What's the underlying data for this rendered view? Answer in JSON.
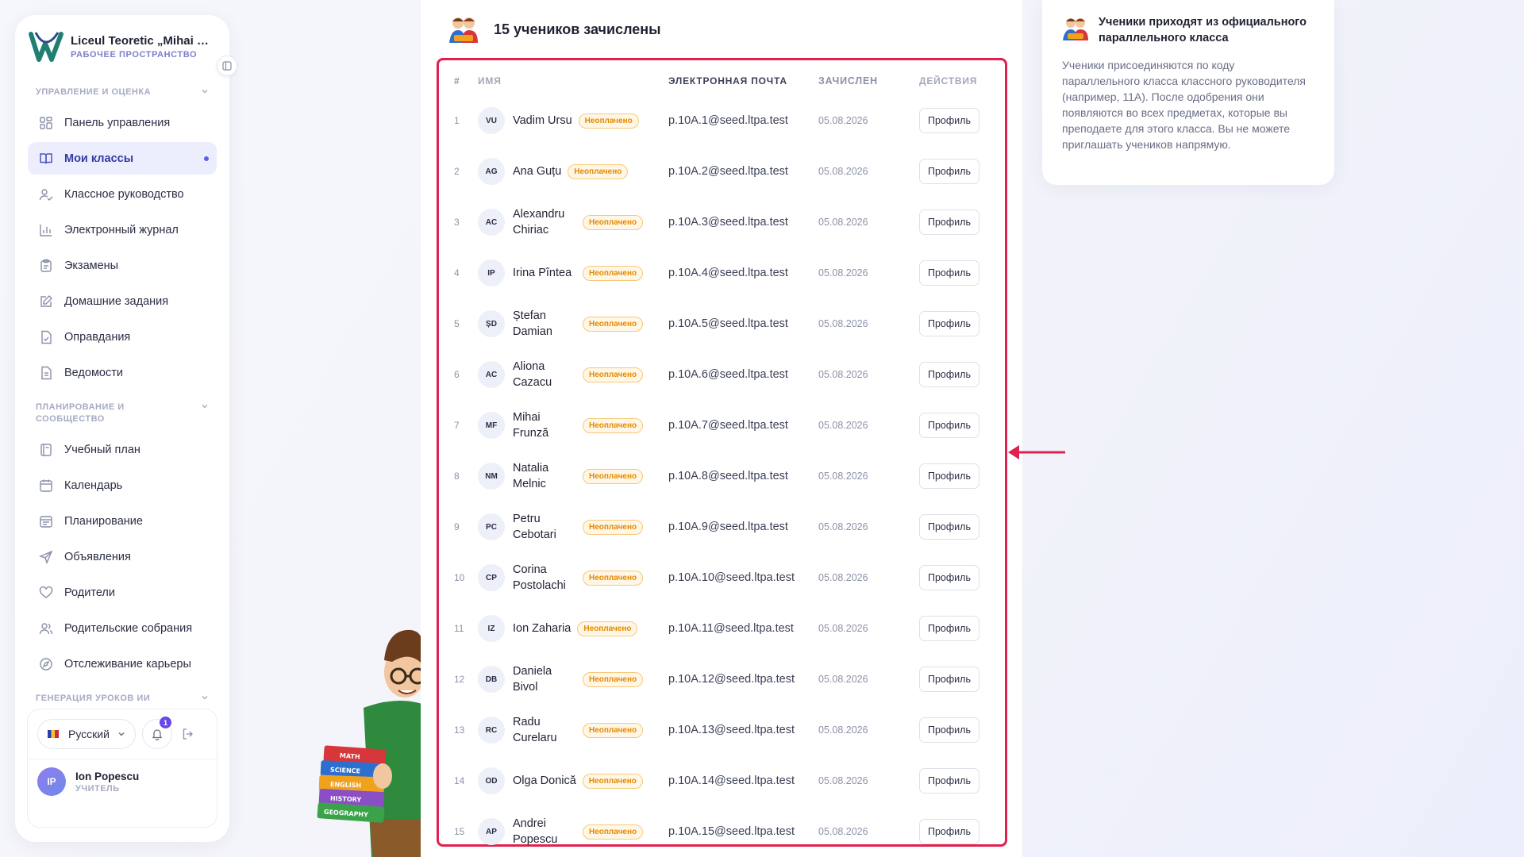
{
  "sidebar": {
    "school_name": "Liceul Teoretic „Mihai Emi...",
    "workspace_label": "РАБОЧЕЕ ПРОСТРАНСТВО",
    "sections": [
      {
        "title": "УПРАВЛЕНИЕ И ОЦЕНКА",
        "items": [
          {
            "label": "Панель управления",
            "icon": "dashboard-icon"
          },
          {
            "label": "Мои классы",
            "icon": "book-icon",
            "active": true
          },
          {
            "label": "Классное руководство",
            "icon": "user-check-icon"
          },
          {
            "label": "Электронный журнал",
            "icon": "bar-chart-icon"
          },
          {
            "label": "Экзамены",
            "icon": "clipboard-icon"
          },
          {
            "label": "Домашние задания",
            "icon": "edit-icon"
          },
          {
            "label": "Оправдания",
            "icon": "file-check-icon"
          },
          {
            "label": "Ведомости",
            "icon": "file-text-icon"
          }
        ]
      },
      {
        "title": "ПЛАНИРОВАНИЕ И СООБЩЕСТВО",
        "items": [
          {
            "label": "Учебный план",
            "icon": "notebook-icon"
          },
          {
            "label": "Календарь",
            "icon": "calendar-icon"
          },
          {
            "label": "Планирование",
            "icon": "calendar-lines-icon"
          },
          {
            "label": "Объявления",
            "icon": "send-icon"
          },
          {
            "label": "Родители",
            "icon": "heart-icon"
          },
          {
            "label": "Родительские собрания",
            "icon": "users-icon"
          },
          {
            "label": "Отслеживание карьеры",
            "icon": "compass-icon"
          }
        ]
      },
      {
        "title": "ГЕНЕРАЦИЯ УРОКОВ ИИ",
        "items": []
      }
    ],
    "footer": {
      "language": "Русский",
      "notifications_count": "1",
      "user_initials": "IP",
      "user_name": "Ion Popescu",
      "user_role": "УЧИТЕЛЬ"
    }
  },
  "main": {
    "title": "15 учеников зачислены",
    "columns": [
      "#",
      "ИМЯ",
      "ЭЛЕКТРОННАЯ ПОЧТА",
      "ЗАЧИСЛЕН",
      "ДЕЙСТВИЯ"
    ],
    "badge_label": "Неоплачено",
    "action_label": "Профиль",
    "students": [
      {
        "n": "1",
        "initials": "VU",
        "name": "Vadim Ursu",
        "email": "p.10A.1@seed.ltpa.test",
        "date": "05.08.2026"
      },
      {
        "n": "2",
        "initials": "AG",
        "name": "Ana Guțu",
        "email": "p.10A.2@seed.ltpa.test",
        "date": "05.08.2026"
      },
      {
        "n": "3",
        "initials": "AC",
        "name": "Alexandru Chiriac",
        "email": "p.10A.3@seed.ltpa.test",
        "date": "05.08.2026"
      },
      {
        "n": "4",
        "initials": "IP",
        "name": "Irina Pîntea",
        "email": "p.10A.4@seed.ltpa.test",
        "date": "05.08.2026"
      },
      {
        "n": "5",
        "initials": "ȘD",
        "name": "Ștefan Damian",
        "email": "p.10A.5@seed.ltpa.test",
        "date": "05.08.2026"
      },
      {
        "n": "6",
        "initials": "AC",
        "name": "Aliona Cazacu",
        "email": "p.10A.6@seed.ltpa.test",
        "date": "05.08.2026"
      },
      {
        "n": "7",
        "initials": "MF",
        "name": "Mihai Frunză",
        "email": "p.10A.7@seed.ltpa.test",
        "date": "05.08.2026"
      },
      {
        "n": "8",
        "initials": "NM",
        "name": "Natalia Melnic",
        "email": "p.10A.8@seed.ltpa.test",
        "date": "05.08.2026"
      },
      {
        "n": "9",
        "initials": "PC",
        "name": "Petru Cebotari",
        "email": "p.10A.9@seed.ltpa.test",
        "date": "05.08.2026"
      },
      {
        "n": "10",
        "initials": "CP",
        "name": "Corina Postolachi",
        "email": "p.10A.10@seed.ltpa.test",
        "date": "05.08.2026"
      },
      {
        "n": "11",
        "initials": "IZ",
        "name": "Ion Zaharia",
        "email": "p.10A.11@seed.ltpa.test",
        "date": "05.08.2026"
      },
      {
        "n": "12",
        "initials": "DB",
        "name": "Daniela Bivol",
        "email": "p.10A.12@seed.ltpa.test",
        "date": "05.08.2026"
      },
      {
        "n": "13",
        "initials": "RC",
        "name": "Radu Curelaru",
        "email": "p.10A.13@seed.ltpa.test",
        "date": "05.08.2026"
      },
      {
        "n": "14",
        "initials": "OD",
        "name": "Olga Donică",
        "email": "p.10A.14@seed.ltpa.test",
        "date": "05.08.2026"
      },
      {
        "n": "15",
        "initials": "AP",
        "name": "Andrei Popescu",
        "email": "p.10A.15@seed.ltpa.test",
        "date": "05.08.2026"
      }
    ]
  },
  "info": {
    "title": "Ученики приходят из официального параллельного класса",
    "body": "Ученики присоединяются по коду параллельного класса классного руководителя (например, 11A). После одобрения они появляются во всех предметах, которые вы преподаете для этого класса. Вы не можете приглашать учеников напрямую."
  },
  "mascot": {
    "books": [
      "MATH",
      "SCIENCE",
      "ENGLISH",
      "HISTORY",
      "GEOGRAPHY"
    ]
  },
  "colors": {
    "accent": "#5b61e6",
    "highlight_frame": "#e0214f",
    "badge_text": "#e38a00"
  }
}
